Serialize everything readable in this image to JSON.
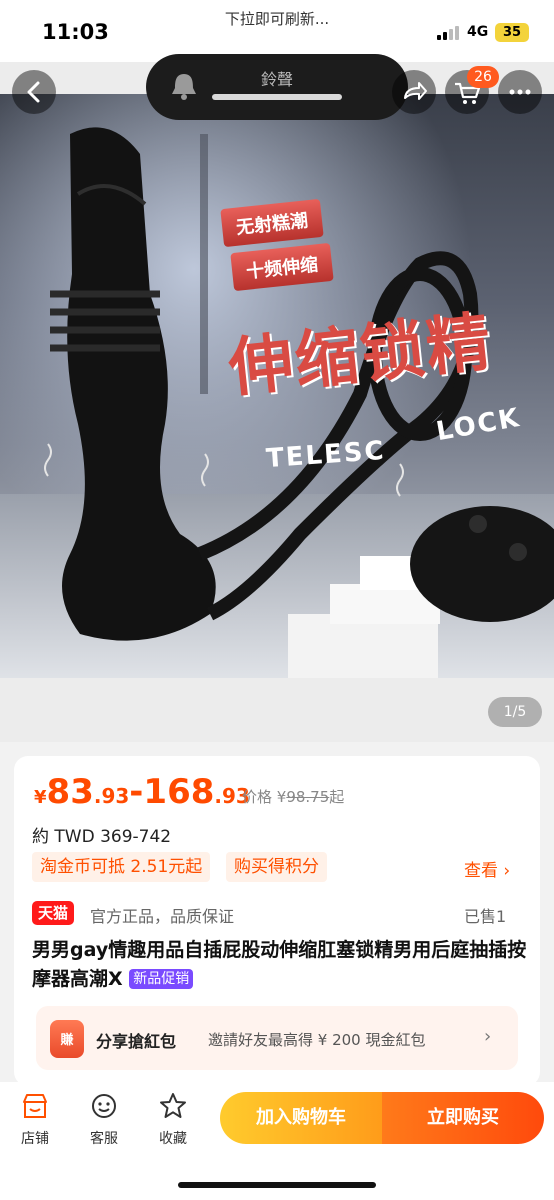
{
  "status_bar": {
    "time": "11:03",
    "notice": "下拉即可刷新...",
    "network": "4G",
    "battery": "35"
  },
  "overlay": {
    "ringer_label": "鈴聲",
    "cart_count": "26"
  },
  "gallery": {
    "tag_1": "无射糕潮",
    "tag_2": "十频伸缩",
    "headline": "伸缩锁精",
    "eng_left": "TELESC",
    "eng_right": "LOCK",
    "page_indicator": "1/5"
  },
  "product": {
    "price_symbol": "¥",
    "price_low_int": "83",
    "price_low_dec": ".93",
    "price_sep": "-",
    "price_high_int": "168",
    "price_high_dec": ".93",
    "orig_label": "价格 ¥",
    "orig_value": "98.75",
    "orig_suffix": "起",
    "twd": "約 TWD 369-742",
    "coupon_1": "淘金币可抵 2.51元起",
    "coupon_2": "购买得积分",
    "see_more": "查看 ›",
    "store_badge": "天猫",
    "guarantee": "官方正品，品质保证",
    "sold": "已售1",
    "title": "男男gay情趣用品自插屁股动伸缩肛塞锁精男用后庭抽插按摩器高潮X",
    "promo_badge": "新品促销"
  },
  "share": {
    "icon_text": "賺",
    "title": "分享搶紅包",
    "desc": "邀請好友最高得 ¥ 200 現金紅包",
    "arrow": "›"
  },
  "bottom_bar": {
    "store": "店铺",
    "service": "客服",
    "favorite": "收藏",
    "add_to_cart": "加入购物车",
    "buy_now": "立即购买"
  },
  "colors": {
    "accent": "#ff5000",
    "price": "#ff4a00",
    "tmall": "#ff1a1a",
    "promo": "#7a4bff"
  }
}
